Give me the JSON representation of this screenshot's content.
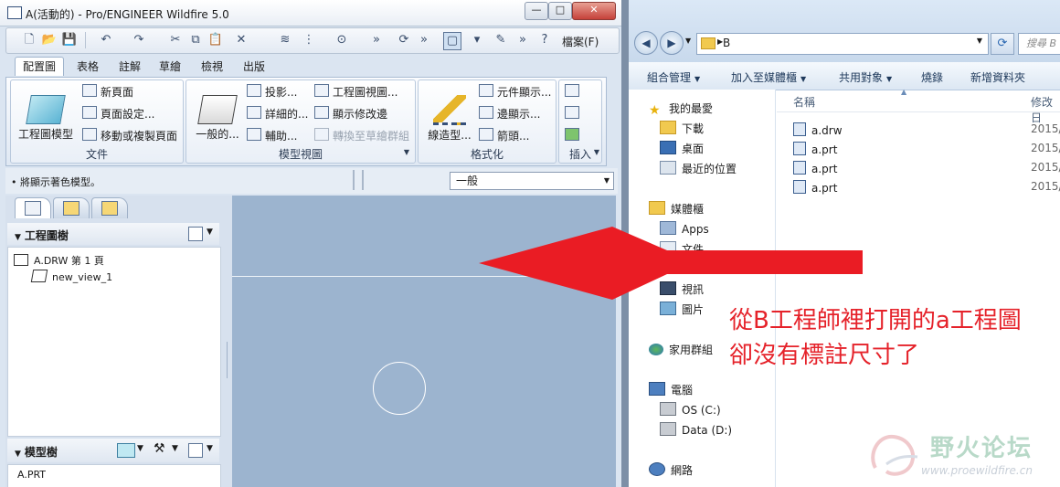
{
  "proe": {
    "title": "A(活動的) - Pro/ENGINEER Wildfire 5.0",
    "qat_help": "檔案(F)",
    "ribbon_tabs": [
      "配置圖",
      "表格",
      "註解",
      "草繪",
      "檢視",
      "出版"
    ],
    "groups": {
      "file": {
        "label": "文件",
        "big": "工程圖模型",
        "items": [
          "新頁面",
          "頁面設定...",
          "移動或複製頁面"
        ]
      },
      "model_view": {
        "label": "模型視圖",
        "big": "一般的...",
        "items": [
          "投影...",
          "詳細的...",
          "輔助...",
          "工程圖視圖...",
          "顯示修改邊",
          "轉換至草繪群組"
        ]
      },
      "format": {
        "label": "格式化",
        "big": "線造型...",
        "items": [
          "元件顯示...",
          "邊顯示...",
          "箭頭..."
        ]
      },
      "insert": {
        "label": "插入"
      }
    },
    "status_message": "• 將顯示著色模型。",
    "display_combo": "一般",
    "nav": {
      "drawing_tree_title": "工程圖樹",
      "drawing_nodes": [
        "A.DRW 第 1 頁",
        "new_view_1"
      ],
      "model_tree_title": "模型樹",
      "model_nodes": [
        "A.PRT"
      ]
    }
  },
  "explorer": {
    "address": "B",
    "search_placeholder": "搜尋 B",
    "commands": [
      "組合管理",
      "加入至媒體櫃",
      "共用對象",
      "燒錄",
      "新增資料夾"
    ],
    "nav_items": [
      "我的最愛",
      "下載",
      "桌面",
      "最近的位置",
      "媒體櫃",
      "Apps",
      "文件",
      "視訊",
      "圖片",
      "家用群組",
      "電腦",
      "OS (C:)",
      "Data (D:)",
      "網路"
    ],
    "columns": [
      "名稱",
      "修改日"
    ],
    "files": [
      {
        "name": "a.drw",
        "date": "2015/"
      },
      {
        "name": "a.prt",
        "date": "2015/"
      },
      {
        "name": "a.prt",
        "date": "2015/"
      },
      {
        "name": "a.prt",
        "date": "2015/"
      }
    ]
  },
  "annotation": {
    "line1": "從B工程師裡打開的a工程圖",
    "line2": "卻沒有標註尺寸了",
    "color": "#e5222a"
  },
  "watermark": {
    "text": "野火论坛",
    "url": "www.proewildfire.cn"
  }
}
